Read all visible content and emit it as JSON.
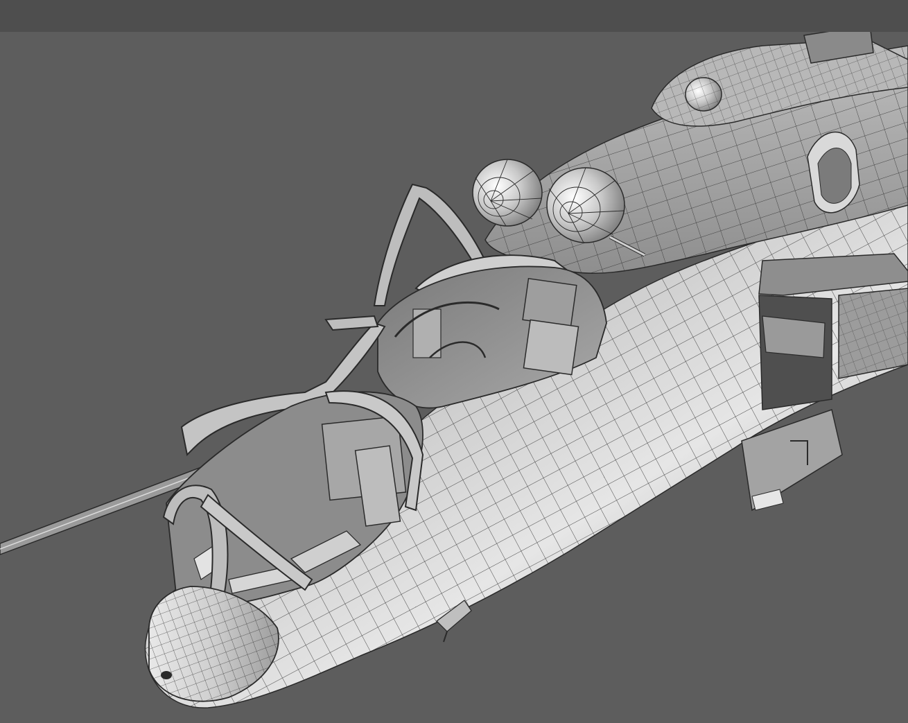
{
  "viewport": {
    "background": "#5d5d5d",
    "top_strip": "#4e4e4e",
    "mesh_light": "#d8d8d8",
    "mesh_mid": "#a9a9a9",
    "mesh_dark": "#5e5e5e",
    "wire": "#2a2a2a",
    "model_icon": "helicopter-wireframe-icon"
  }
}
